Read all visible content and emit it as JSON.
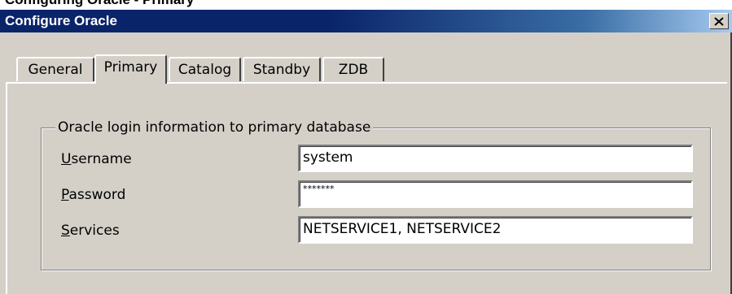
{
  "heading": "Configuring Oracle - Primary",
  "window": {
    "title": "Configure Oracle",
    "close_glyph": "✕"
  },
  "tabs": [
    {
      "label": "General",
      "active": false
    },
    {
      "label": "Primary",
      "active": true
    },
    {
      "label": "Catalog",
      "active": false
    },
    {
      "label": "Standby",
      "active": false
    },
    {
      "label": "ZDB",
      "active": false
    }
  ],
  "group": {
    "label": "Oracle login information to primary database"
  },
  "fields": {
    "username": {
      "mnemonic": "U",
      "label_rest": "sername",
      "value": "system"
    },
    "password": {
      "mnemonic": "P",
      "label_rest": "assword",
      "value": "*******"
    },
    "services": {
      "mnemonic": "S",
      "label_rest": "ervices",
      "value": "NETSERVICE1, NETSERVICE2"
    }
  },
  "colors": {
    "title_bar": "#0a246a",
    "dialog_face": "#d4d0c8"
  }
}
